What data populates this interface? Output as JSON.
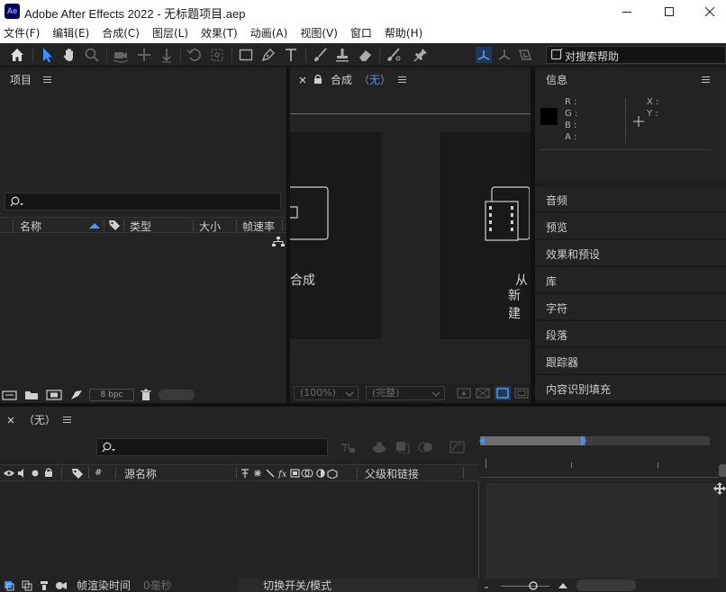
{
  "window": {
    "logo_text": "Ae",
    "title": "Adobe After Effects 2022 - 无标题项目.aep"
  },
  "menu": {
    "items": [
      "文件(F)",
      "编辑(E)",
      "合成(C)",
      "图层(L)",
      "效果(T)",
      "动画(A)",
      "视图(V)",
      "窗口",
      "帮助(H)"
    ]
  },
  "toolbar": {
    "search_help_label": "对搜索帮助"
  },
  "project_panel": {
    "title": "项目",
    "columns": {
      "name": "名称",
      "type": "类型",
      "size": "大小",
      "fps": "帧速率"
    },
    "bpc_label": "8 bpc"
  },
  "comp_panel": {
    "title": "合成",
    "title_suffix": "（无）",
    "new_comp_partial": "合成",
    "from_footage_partial_1": "从",
    "from_footage_partial_2": "新建",
    "zoom_value": "(100%)",
    "quality_value": "(完整)"
  },
  "info_panel": {
    "title": "信息",
    "labels": {
      "r": "R :",
      "g": "G :",
      "b": "B :",
      "a": "A :",
      "x": "X :",
      "y": "Y :"
    }
  },
  "side_panels": [
    "音频",
    "预览",
    "效果和预设",
    "库",
    "字符",
    "段落",
    "跟踪器",
    "内容识别填充"
  ],
  "timeline": {
    "tab_title": "（无）",
    "columns": {
      "hash": "#",
      "source_name": "源名称",
      "parent_link": "父级和链接"
    },
    "footer": {
      "render_time_label": "帧渲染时间",
      "render_time_value": "0毫秒",
      "switches_label": "切换开关/模式"
    }
  }
}
